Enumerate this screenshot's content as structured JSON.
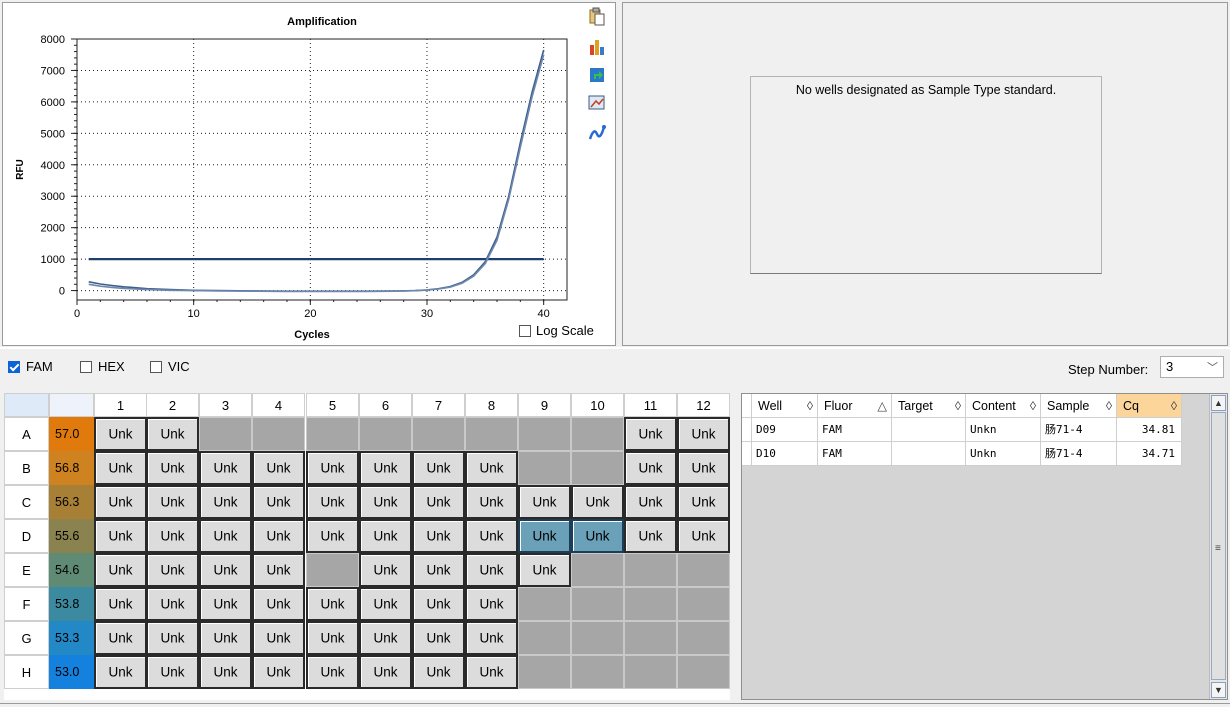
{
  "chart": {
    "title": "Amplification",
    "xlabel": "Cycles",
    "ylabel": "RFU",
    "log_scale_label": "Log Scale",
    "log_scale_checked": false,
    "toolbar_icons": [
      "copy-icon",
      "chart-bars-icon",
      "export-icon",
      "zoom-image-icon",
      "curve-settings-icon"
    ]
  },
  "chart_data": {
    "type": "line",
    "title": "Amplification",
    "xlabel": "Cycles",
    "ylabel": "RFU",
    "xlim": [
      0,
      42
    ],
    "ylim": [
      -300,
      8000
    ],
    "x_ticks": [
      0,
      10,
      20,
      30,
      40
    ],
    "y_ticks": [
      0,
      1000,
      2000,
      3000,
      4000,
      5000,
      6000,
      7000,
      8000
    ],
    "grid": true,
    "threshold": 1000,
    "series": [
      {
        "color": "#3c5f8e",
        "x": [
          1,
          2,
          3,
          4,
          5,
          6,
          8,
          10,
          12,
          15,
          18,
          20,
          22,
          25,
          27,
          28,
          29,
          30,
          31,
          32,
          33,
          34,
          35,
          36,
          37,
          38,
          39,
          40
        ],
        "values": [
          280,
          210,
          160,
          120,
          90,
          60,
          30,
          10,
          0,
          -10,
          -20,
          -20,
          -20,
          -20,
          -15,
          -10,
          0,
          20,
          60,
          130,
          260,
          500,
          920,
          1700,
          3000,
          4700,
          6300,
          7650
        ]
      },
      {
        "color": "#6e88ad",
        "x": [
          1,
          2,
          3,
          4,
          5,
          6,
          8,
          10,
          12,
          15,
          18,
          20,
          22,
          25,
          27,
          28,
          29,
          30,
          31,
          32,
          33,
          34,
          35,
          36,
          37,
          38,
          39,
          40
        ],
        "values": [
          200,
          140,
          100,
          70,
          50,
          30,
          10,
          0,
          -10,
          -20,
          -25,
          -25,
          -25,
          -25,
          -20,
          -15,
          -5,
          15,
          50,
          110,
          230,
          460,
          860,
          1600,
          2900,
          4550,
          6150,
          7500
        ]
      }
    ]
  },
  "standard_curve": {
    "message": "No wells designated as Sample Type standard."
  },
  "fluors": [
    {
      "label": "FAM",
      "checked": true
    },
    {
      "label": "HEX",
      "checked": false
    },
    {
      "label": "VIC",
      "checked": false
    }
  ],
  "step": {
    "label": "Step Number:",
    "value": "3"
  },
  "plate": {
    "columns": [
      "1",
      "2",
      "3",
      "4",
      "5",
      "6",
      "7",
      "8",
      "9",
      "10",
      "11",
      "12"
    ],
    "rows": [
      "A",
      "B",
      "C",
      "D",
      "E",
      "F",
      "G",
      "H"
    ],
    "temps": [
      "57.0",
      "56.8",
      "56.3",
      "55.6",
      "54.6",
      "53.8",
      "53.3",
      "53.0"
    ],
    "temp_colors": [
      "#e07a0c",
      "#cf8320",
      "#a88035",
      "#8a824f",
      "#5f8a73",
      "#3b8aa0",
      "#2388c6",
      "#1581de"
    ],
    "well_label": "Unk",
    "wells": [
      [
        1,
        1,
        0,
        0,
        0,
        0,
        0,
        0,
        0,
        0,
        1,
        1
      ],
      [
        1,
        1,
        1,
        1,
        1,
        1,
        1,
        1,
        0,
        0,
        1,
        1
      ],
      [
        1,
        1,
        1,
        1,
        1,
        1,
        1,
        1,
        1,
        1,
        1,
        1
      ],
      [
        1,
        1,
        1,
        1,
        1,
        1,
        1,
        1,
        2,
        2,
        1,
        1
      ],
      [
        1,
        1,
        1,
        1,
        0,
        1,
        1,
        1,
        1,
        0,
        0,
        0
      ],
      [
        1,
        1,
        1,
        1,
        1,
        1,
        1,
        1,
        0,
        0,
        0,
        0
      ],
      [
        1,
        1,
        1,
        1,
        1,
        1,
        1,
        1,
        0,
        0,
        0,
        0
      ],
      [
        1,
        1,
        1,
        1,
        1,
        1,
        1,
        1,
        0,
        0,
        0,
        0
      ]
    ]
  },
  "table": {
    "headers": [
      "Well",
      "Fluor",
      "Target",
      "Content",
      "Sample",
      "Cq"
    ],
    "sort_marks": [
      "◊",
      "△",
      "◊",
      "◊",
      "◊",
      "◊"
    ],
    "rows": [
      {
        "well": "D09",
        "fluor": "FAM",
        "target": "",
        "content": "Unkn",
        "sample": "肠71-4",
        "cq": "34.81"
      },
      {
        "well": "D10",
        "fluor": "FAM",
        "target": "",
        "content": "Unkn",
        "sample": "肠71-4",
        "cq": "34.71"
      }
    ]
  }
}
